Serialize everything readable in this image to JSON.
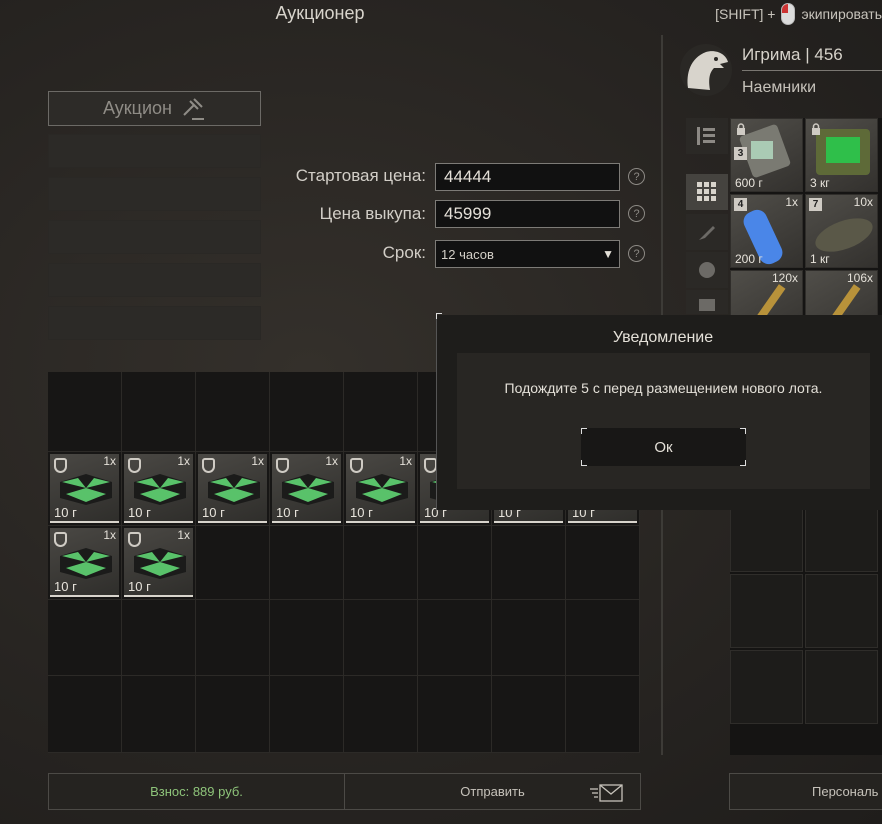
{
  "header": {
    "title": "Аукционер",
    "hint_shift": "[SHIFT] +",
    "hint_action": "экипировать"
  },
  "left_panel": {
    "auction_label": "Аукцион"
  },
  "form": {
    "start_price_label": "Стартовая цена:",
    "start_price_value": "44444",
    "buyout_label": "Цена выкупа:",
    "buyout_value": "45999",
    "term_label": "Срок:",
    "term_value": "12 часов",
    "help_glyph": "?"
  },
  "stash_items": [
    {
      "qty": "1x",
      "weight": "10 г"
    },
    {
      "qty": "1x",
      "weight": "10 г"
    },
    {
      "qty": "1x",
      "weight": "10 г"
    },
    {
      "qty": "1x",
      "weight": "10 г"
    },
    {
      "qty": "1x",
      "weight": "10 г"
    },
    {
      "qty": "",
      "weight": "10 г"
    },
    {
      "qty": "",
      "weight": "10 г"
    },
    {
      "qty": "",
      "weight": "10 г"
    },
    {
      "qty": "1x",
      "weight": "10 г"
    },
    {
      "qty": "1x",
      "weight": "10 г"
    }
  ],
  "bottom_bar": {
    "fee": "Взнос: 889 руб.",
    "send": "Отправить"
  },
  "profile": {
    "name": "Игрима | 456",
    "faction": "Наемники"
  },
  "inventory": [
    {
      "weight": "600 г",
      "badge": "3",
      "qty": ""
    },
    {
      "weight": "3 кг",
      "badge": "",
      "qty": ""
    },
    {
      "weight": "200 г",
      "badge": "4",
      "qty": "1x"
    },
    {
      "weight": "1 кг",
      "badge": "7",
      "qty": "10x"
    },
    {
      "weight": "",
      "badge": "",
      "qty": "120x"
    },
    {
      "weight": "",
      "badge": "",
      "qty": "106x"
    }
  ],
  "personal_button": "Персональ",
  "modal": {
    "title": "Уведомление",
    "message": "Подождите 5 с перед размещением нового лота.",
    "ok_label": "Ок"
  },
  "colors": {
    "fee_text": "#8ec47a",
    "case_green": "#59c26a"
  }
}
